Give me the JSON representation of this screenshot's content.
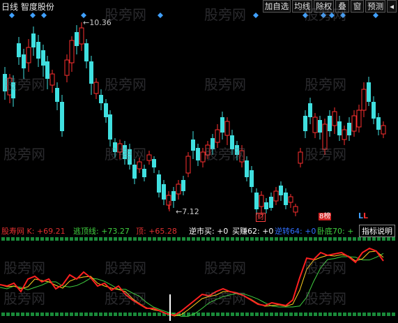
{
  "window": {
    "title": "日线 智度股份"
  },
  "toolbar": {
    "buttons": [
      "加自选",
      "均线",
      "除权",
      "叠",
      "窗",
      "预测",
      "◂"
    ]
  },
  "watermark": "股旁网",
  "price_labels": {
    "high": "10.36",
    "low": "7.12"
  },
  "markers": {
    "cai": "财",
    "blue_label": "L",
    "red_label": "L",
    "box_label": "8榜"
  },
  "indicators": [
    {
      "label": "股寿网 K: +69.21",
      "color": "#e03030"
    },
    {
      "label": "逃顶线: +73.27",
      "color": "#40d040"
    },
    {
      "label": "顶: +65.28",
      "color": "#e03030"
    },
    {
      "label": "逆市买: +0",
      "color": "#ffffff"
    },
    {
      "label": "买赚62: +0",
      "color": "#ffffff"
    },
    {
      "label": "逆转64: +0",
      "color": "#3070ff"
    },
    {
      "label": "卧底70: +",
      "color": "#40d040"
    }
  ],
  "indicator_help": "指标说明",
  "colors": {
    "up": "#ff3030",
    "down": "#40e0e0",
    "line_k": "#ff2020",
    "line_signal": "#ffd020",
    "line_green": "#40d040",
    "diamond": "#40a0ff"
  }
}
